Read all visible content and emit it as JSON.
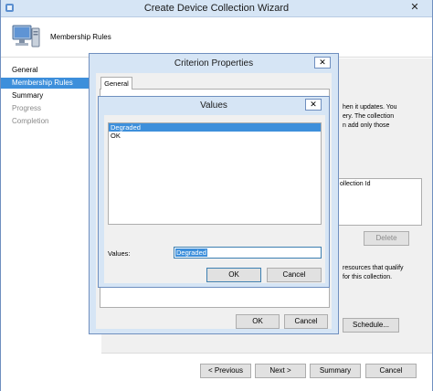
{
  "window": {
    "title": "Create Device Collection Wizard",
    "close_glyph": "✕"
  },
  "header": {
    "title": "Membership Rules"
  },
  "nav": {
    "items": [
      {
        "label": "General",
        "state": "normal"
      },
      {
        "label": "Membership Rules",
        "state": "selected"
      },
      {
        "label": "Summary",
        "state": "normal"
      },
      {
        "label": "Progress",
        "state": "disabled"
      },
      {
        "label": "Completion",
        "state": "disabled"
      }
    ]
  },
  "content": {
    "text_lines": [
      "hen it updates. You",
      "ery. The collection",
      "n add only those",
      "ollection Id",
      "resources that qualify",
      "for this collection."
    ],
    "delete_label": "Delete",
    "schedule_label": "Schedule..."
  },
  "footer": {
    "previous_label": "< Previous",
    "next_label": "Next >",
    "summary_label": "Summary",
    "cancel_label": "Cancel"
  },
  "criterion_dialog": {
    "title": "Criterion Properties",
    "close_glyph": "✕",
    "tab_general": "General",
    "ok_label": "OK",
    "cancel_label": "Cancel"
  },
  "values_dialog": {
    "title": "Values",
    "close_glyph": "✕",
    "list": [
      {
        "label": "Degraded",
        "selected": true
      },
      {
        "label": "OK",
        "selected": false
      }
    ],
    "values_label": "Values:",
    "values_input": "Degraded",
    "ok_label": "OK",
    "cancel_label": "Cancel"
  },
  "colors": {
    "title_bar": "#d6e5f5",
    "selection": "#3d8fdb",
    "border": "#6f8fbf"
  }
}
